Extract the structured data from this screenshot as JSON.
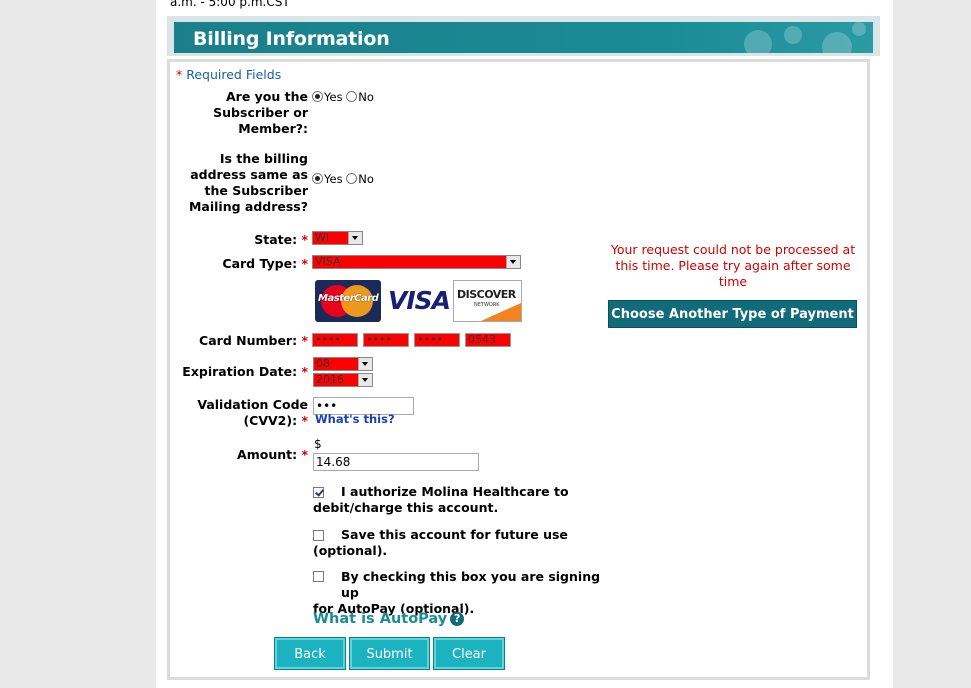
{
  "top_text": "a.m. - 5:00 p.m.CST",
  "banner": {
    "title": "Billing Information"
  },
  "required": {
    "star": "*",
    "text": "Required Fields"
  },
  "subscriber": {
    "label_lines": [
      "Are you the",
      "Subscriber or",
      "Member?:"
    ],
    "yes": "Yes",
    "no": "No"
  },
  "billing_same": {
    "label_lines": [
      "Is the billing",
      "address same as",
      "the Subscriber",
      "Mailing address?"
    ],
    "yes": "Yes",
    "no": "No"
  },
  "state": {
    "label": "State:",
    "value": "WI"
  },
  "card_type": {
    "label": "Card Type:",
    "value": "VISA"
  },
  "card_logos": {
    "mastercard": "MasterCard",
    "visa": "VISA",
    "discover": "DISCOVER",
    "discover_sub": "NETWORK"
  },
  "card_number": {
    "label": "Card Number:",
    "parts": [
      "••••",
      "••••",
      "••••",
      "0543"
    ]
  },
  "expiration": {
    "label": "Expiration Date:",
    "month": "08",
    "year": "2016"
  },
  "cvv": {
    "label_lines": [
      "Validation Code",
      "(CVV2):"
    ],
    "value": "•••",
    "help": "What's this?"
  },
  "amount": {
    "label": "Amount:",
    "currency": "$",
    "value": "14.68"
  },
  "authorize": {
    "text_lines": [
      "I authorize Molina Healthcare to",
      "debit/charge this account."
    ],
    "checked": true
  },
  "save_account": {
    "text_lines": [
      "Save this account for future use",
      "(optional)."
    ],
    "checked": false
  },
  "autopay": {
    "text_lines": [
      "By checking this box you are signing up",
      "for AutoPay (optional)."
    ],
    "checked": false
  },
  "autopay_link": {
    "text": "What is AutoPay",
    "icon": "?"
  },
  "error": {
    "message": "Your request could not be processed at this time. Please try again after some time"
  },
  "choose_button": "Choose Another Type of Payment",
  "buttons": {
    "back": "Back",
    "submit": "Submit",
    "clear": "Clear"
  },
  "colors": {
    "banner": "#1a8c96",
    "error": "#d00000",
    "field_error": "#ff0000",
    "button": "#1cb3c0"
  }
}
